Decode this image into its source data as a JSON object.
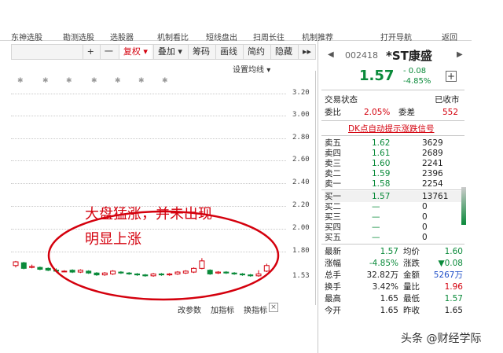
{
  "menu": [
    "东神选股",
    "勘测选股",
    "选股器",
    "机制看比",
    "短线盘出",
    "扫周长往",
    "机制推荐",
    "打开导航",
    "返回"
  ],
  "toolbar": {
    "plus": "+",
    "minus": "一",
    "fuquan": "复权",
    "overlay": "叠加",
    "chips": "筹码",
    "draw": "画线",
    "simple": "简约",
    "hide": "隐藏",
    "more": "▸▸"
  },
  "chart": {
    "settings_label": "设置均线",
    "y_labels": [
      "3.20",
      "3.00",
      "2.80",
      "2.60",
      "2.40",
      "2.20",
      "2.00",
      "1.80",
      "1.53"
    ],
    "star_glyph": "✱",
    "bottom": {
      "edit_params": "改参数",
      "add_indicator": "加指标",
      "change_indicator": "换指标",
      "close": "×"
    },
    "annotation": {
      "line1": "大盘猛涨，并未出现",
      "line2": "明显上涨"
    }
  },
  "chart_data": {
    "type": "candlestick",
    "ylim": [
      1.53,
      3.2
    ],
    "candles": [
      {
        "o": 1.65,
        "c": 1.69,
        "h": 1.7,
        "l": 1.63
      },
      {
        "o": 1.68,
        "c": 1.62,
        "h": 1.69,
        "l": 1.61
      },
      {
        "o": 1.63,
        "c": 1.64,
        "h": 1.66,
        "l": 1.62
      },
      {
        "o": 1.63,
        "c": 1.61,
        "h": 1.64,
        "l": 1.6
      },
      {
        "o": 1.62,
        "c": 1.6,
        "h": 1.63,
        "l": 1.59
      },
      {
        "o": 1.6,
        "c": 1.59,
        "h": 1.62,
        "l": 1.58
      },
      {
        "o": 1.59,
        "c": 1.59,
        "h": 1.6,
        "l": 1.58
      },
      {
        "o": 1.6,
        "c": 1.58,
        "h": 1.61,
        "l": 1.57
      },
      {
        "o": 1.58,
        "c": 1.6,
        "h": 1.61,
        "l": 1.57
      },
      {
        "o": 1.59,
        "c": 1.57,
        "h": 1.6,
        "l": 1.56
      },
      {
        "o": 1.57,
        "c": 1.55,
        "h": 1.58,
        "l": 1.54
      },
      {
        "o": 1.55,
        "c": 1.57,
        "h": 1.58,
        "l": 1.54
      },
      {
        "o": 1.56,
        "c": 1.59,
        "h": 1.6,
        "l": 1.55
      },
      {
        "o": 1.58,
        "c": 1.57,
        "h": 1.59,
        "l": 1.56
      },
      {
        "o": 1.57,
        "c": 1.56,
        "h": 1.58,
        "l": 1.55
      },
      {
        "o": 1.56,
        "c": 1.55,
        "h": 1.57,
        "l": 1.54
      },
      {
        "o": 1.55,
        "c": 1.54,
        "h": 1.56,
        "l": 1.53
      },
      {
        "o": 1.54,
        "c": 1.56,
        "h": 1.57,
        "l": 1.53
      },
      {
        "o": 1.56,
        "c": 1.55,
        "h": 1.57,
        "l": 1.54
      },
      {
        "o": 1.55,
        "c": 1.56,
        "h": 1.57,
        "l": 1.54
      },
      {
        "o": 1.56,
        "c": 1.58,
        "h": 1.59,
        "l": 1.55
      },
      {
        "o": 1.57,
        "c": 1.59,
        "h": 1.6,
        "l": 1.56
      },
      {
        "o": 1.58,
        "c": 1.62,
        "h": 1.63,
        "l": 1.57
      },
      {
        "o": 1.62,
        "c": 1.7,
        "h": 1.73,
        "l": 1.61
      },
      {
        "o": 1.6,
        "c": 1.56,
        "h": 1.61,
        "l": 1.55
      },
      {
        "o": 1.57,
        "c": 1.58,
        "h": 1.59,
        "l": 1.56
      },
      {
        "o": 1.58,
        "c": 1.57,
        "h": 1.59,
        "l": 1.56
      },
      {
        "o": 1.57,
        "c": 1.56,
        "h": 1.58,
        "l": 1.55
      },
      {
        "o": 1.56,
        "c": 1.55,
        "h": 1.57,
        "l": 1.54
      },
      {
        "o": 1.55,
        "c": 1.54,
        "h": 1.56,
        "l": 1.53
      },
      {
        "o": 1.54,
        "c": 1.56,
        "h": 1.6,
        "l": 1.53
      },
      {
        "o": 1.59,
        "c": 1.65,
        "h": 1.67,
        "l": 1.58
      }
    ],
    "up_color": "#d4000d",
    "down_color": "#0a8a3a"
  },
  "quote": {
    "code": "002418",
    "name": "*ST康盛",
    "price": "1.57",
    "change": "- 0.08",
    "change_pct": "-4.85%",
    "add": "+",
    "status_label": "交易状态",
    "status_value": "已收市",
    "weibi_label": "委比",
    "weibi_value": "2.05%",
    "weicha_label": "委差",
    "weicha_value": "552",
    "dk_text": "DK点自动提示涨跌信号",
    "asks": [
      {
        "label": "卖五",
        "price": "1.62",
        "vol": "3629"
      },
      {
        "label": "卖四",
        "price": "1.61",
        "vol": "2689"
      },
      {
        "label": "卖三",
        "price": "1.60",
        "vol": "2241"
      },
      {
        "label": "卖二",
        "price": "1.59",
        "vol": "2396"
      },
      {
        "label": "卖一",
        "price": "1.58",
        "vol": "2254"
      }
    ],
    "bids": [
      {
        "label": "买一",
        "price": "1.57",
        "vol": "13761"
      },
      {
        "label": "买二",
        "price": "—",
        "vol": "0"
      },
      {
        "label": "买三",
        "price": "—",
        "vol": "0"
      },
      {
        "label": "买四",
        "price": "—",
        "vol": "0"
      },
      {
        "label": "买五",
        "price": "—",
        "vol": "0"
      }
    ],
    "stats": [
      {
        "l1": "最新",
        "v1": "1.57",
        "c1": "green",
        "l2": "均价",
        "v2": "1.60",
        "c2": "green"
      },
      {
        "l1": "涨幅",
        "v1": "-4.85%",
        "c1": "green",
        "l2": "涨跌",
        "v2": "▼0.08",
        "c2": "green"
      },
      {
        "l1": "总手",
        "v1": "32.82万",
        "c1": "",
        "l2": "金额",
        "v2": "5267万",
        "c2": "blue"
      },
      {
        "l1": "换手",
        "v1": "3.42%",
        "c1": "",
        "l2": "量比",
        "v2": "1.96",
        "c2": "red"
      },
      {
        "l1": "最高",
        "v1": "1.65",
        "c1": "",
        "l2": "最低",
        "v2": "1.57",
        "c2": "green"
      },
      {
        "l1": "今开",
        "v1": "1.65",
        "c1": "",
        "l2": "昨收",
        "v2": "1.65",
        "c2": ""
      }
    ]
  },
  "watermark": "头条 @财经学际"
}
